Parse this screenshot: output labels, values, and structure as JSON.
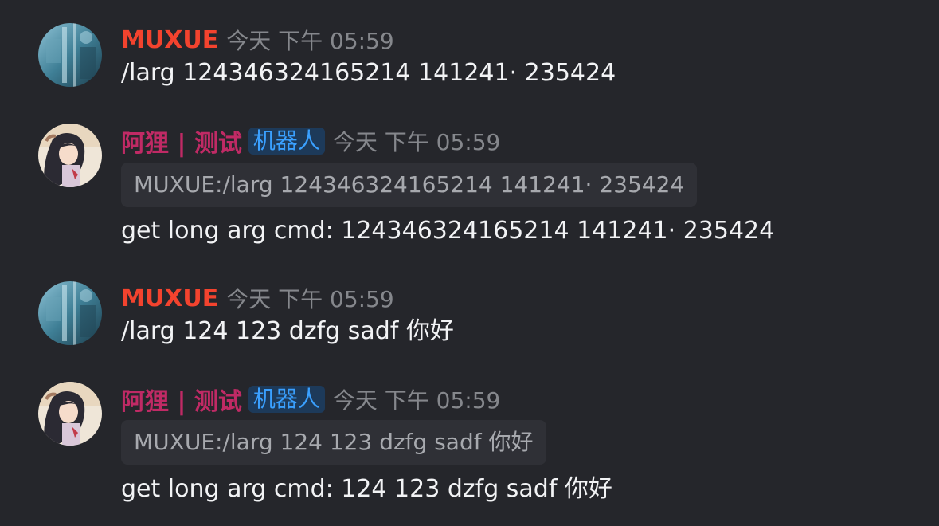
{
  "colors": {
    "background": "#25262b",
    "user_name_color": "#f3432e",
    "bot_name_color": "#c02a65",
    "tag_bg": "#1d3a5a",
    "tag_text": "#3aa0ff",
    "timestamp": "#85878c",
    "quote_bg": "#2f3036"
  },
  "messages": [
    {
      "author": "MUXUE",
      "author_type": "user",
      "avatar_icon": "waterfall-avatar-icon",
      "timestamp": "今天 下午 05:59",
      "text": "/larg 124346324165214 141241· 235424"
    },
    {
      "author": "阿狸 | 测试",
      "author_type": "bot",
      "tag": "机器人",
      "avatar_icon": "anime-character-avatar-icon",
      "timestamp": "今天 下午 05:59",
      "quote": "MUXUE:/larg 124346324165214 141241· 235424",
      "text": "get long arg cmd: 124346324165214 141241· 235424"
    },
    {
      "author": "MUXUE",
      "author_type": "user",
      "avatar_icon": "waterfall-avatar-icon",
      "timestamp": "今天 下午 05:59",
      "text": "/larg 124 123 dzfg sadf 你好"
    },
    {
      "author": "阿狸 | 测试",
      "author_type": "bot",
      "tag": "机器人",
      "avatar_icon": "anime-character-avatar-icon",
      "timestamp": "今天 下午 05:59",
      "quote": "MUXUE:/larg 124 123 dzfg sadf 你好",
      "text": "get long arg cmd: 124 123 dzfg sadf 你好"
    }
  ]
}
